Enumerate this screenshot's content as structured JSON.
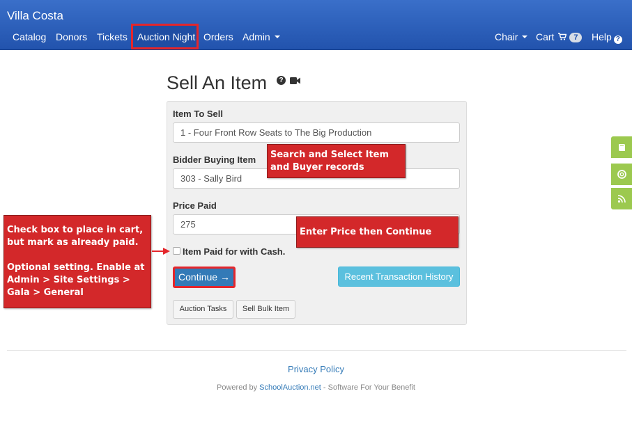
{
  "navbar": {
    "brand": "Villa Costa",
    "items": [
      {
        "label": "Catalog"
      },
      {
        "label": "Donors"
      },
      {
        "label": "Tickets"
      },
      {
        "label": "Auction Night"
      },
      {
        "label": "Orders"
      },
      {
        "label": "Admin"
      }
    ],
    "right": {
      "chair": "Chair",
      "cart": "Cart",
      "cart_count": "7",
      "help": "Help"
    }
  },
  "page": {
    "title": "Sell An Item"
  },
  "form": {
    "item_label": "Item To Sell",
    "item_value": "1 - Four Front Row Seats to The Big Production",
    "bidder_label": "Bidder Buying Item",
    "bidder_value": "303 -  Sally Bird",
    "price_label": "Price Paid",
    "price_value": "275",
    "cash_label": "Item Paid for with Cash.",
    "continue_label": "Continue →",
    "recent_label": "Recent Transaction History",
    "auction_tasks_label": "Auction Tasks",
    "sell_bulk_label": "Sell Bulk Item"
  },
  "callouts": {
    "search": "Search and Select Item\nand Buyer records",
    "price": "Enter Price then Continue",
    "checkbox": "Check box to place in cart,\nbut mark as already paid.\n\nOptional setting.  Enable at\nAdmin > Site Settings >\nGala > General"
  },
  "footer": {
    "privacy": "Privacy Policy",
    "powered_prefix": "Powered by ",
    "powered_link": "SchoolAuction.net",
    "powered_suffix": " - Software For Your Benefit"
  },
  "colors": {
    "navbar": "#2a5db8",
    "highlight": "#e4262b",
    "primary": "#337ab7",
    "info": "#5bc0de",
    "callout": "#d3282a",
    "side_widget": "#9cc94f"
  },
  "side_widgets": [
    "book-icon",
    "lifebuoy-icon",
    "rss-icon"
  ]
}
